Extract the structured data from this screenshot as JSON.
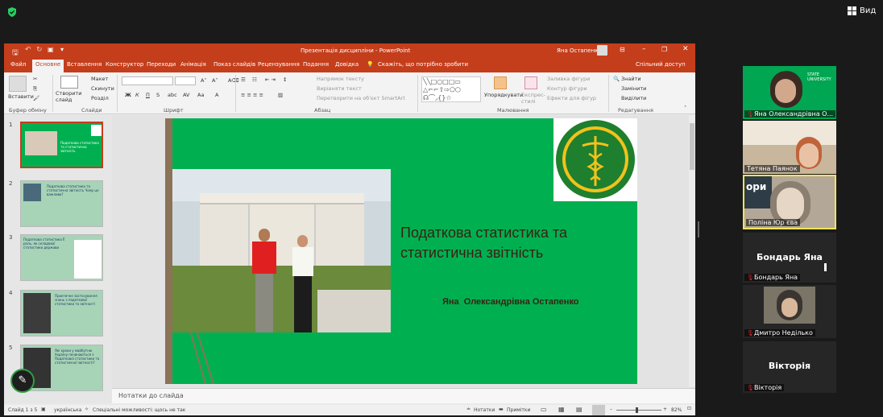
{
  "zoom": {
    "view_label": "Вид",
    "shield_color": "#23d160"
  },
  "ppt": {
    "doc_title": "Презентація дисципліни - PowerPoint",
    "user_name": "Яна Остапенко",
    "tabs": [
      "Файл",
      "Основне",
      "Вставлення",
      "Конструктор",
      "Переходи",
      "Анімація",
      "Показ слайдів",
      "Рецензування",
      "Подання",
      "Довідка"
    ],
    "tell_me": "Скажіть, що потрібно зробити",
    "share": "Спільний доступ",
    "ribbon": {
      "paste": "Вставити",
      "clipboard_group": "Буфер обміну",
      "new_slide": "Створити слайд",
      "layout": "Макет",
      "reset": "Скинути",
      "section": "Розділ",
      "slides_group": "Слайди",
      "font_group": "Шрифт",
      "text_direction": "Напрямок тексту",
      "align_text": "Вирівняти текст",
      "smartart": "Перетворити на об'єкт SmartArt",
      "paragraph_group": "Абзац",
      "arrange": "Упорядкувати",
      "quick_styles": "Експрес-стилі",
      "shape_fill": "Заливка фігури",
      "shape_outline": "Контур фігури",
      "shape_effects": "Ефекти для фігур",
      "drawing_group": "Малювання",
      "find": "Знайти",
      "replace": "Замінити",
      "select": "Виділити",
      "editing_group": "Редагування",
      "font_sample_bold": "Ж",
      "font_sample_italic": "К",
      "font_sample_underline": "П",
      "font_sample_strike": "S"
    },
    "thumbnails": [
      "1",
      "2",
      "3",
      "4",
      "5"
    ],
    "thumb_texts": [
      "Податкова статистика та статистична звітність",
      "Податкова статистика та статистична звітність Чому це важливо?",
      "Податкова статистика Її роль, як складової статистики держави",
      "Практичне застосування знань з податкової статистики та звітності",
      "Які кроки у майбутню Україну починаються з Податкової статистики та статистичної звітності?"
    ],
    "slide": {
      "title": "Податкова статистика та статистична звітність",
      "author": "Яна  Олександрівна Остапенко",
      "bg_color": "#00b050"
    },
    "notes_placeholder": "Нотатки до слайда",
    "status": {
      "slide_of": "Слайд 1 з 5",
      "language": "українська",
      "accessibility": "Спеціальні можливості: щось не так",
      "notes": "Нотатки",
      "comments": "Примітки",
      "zoom": "82%"
    }
  },
  "participants": [
    {
      "name": "Яна Олександрівна О...",
      "video": true
    },
    {
      "name": "Тетяна Паянок",
      "video": true
    },
    {
      "name": "Поліна Юр єва",
      "video": true,
      "active_speaker": true,
      "overlay": "ори"
    },
    {
      "name": "Бондарь Яна",
      "display": "Бондарь Яна",
      "video": false
    },
    {
      "name": "Дмитро Неділько",
      "video": true
    },
    {
      "name": "Вікторія",
      "display": "Вікторія",
      "video": false
    }
  ]
}
